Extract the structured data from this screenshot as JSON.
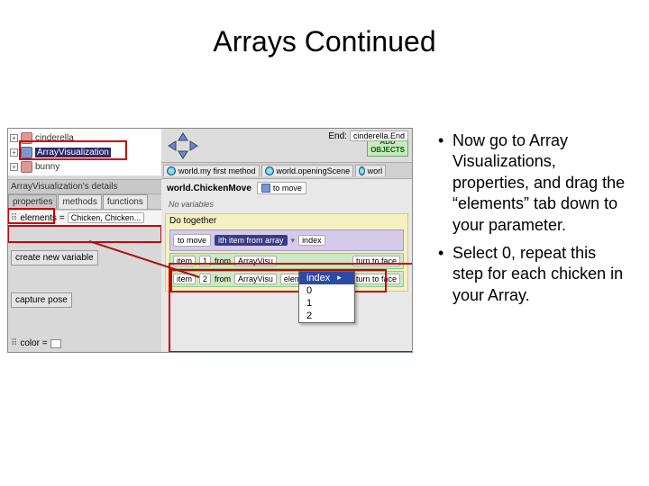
{
  "title": "Arrays Continued",
  "tree": {
    "items": [
      {
        "label": "cinderella"
      },
      {
        "label": "ArrayVisualization"
      },
      {
        "label": "bunny"
      }
    ]
  },
  "details_header": "ArrayVisualization's details",
  "tabs": {
    "properties": "properties",
    "methods": "methods",
    "functions": "functions"
  },
  "property": {
    "name": "elements",
    "equals": "=",
    "value": "Chicken, Chicken..."
  },
  "buttons": {
    "create_var": "create new variable",
    "capture_pose": "capture pose",
    "add_objects": "ADD\nOBJECTS"
  },
  "color_label": "color =",
  "end_label": "End:",
  "end_value": "cinderella.End",
  "method_tabs": {
    "a": "world.my first method",
    "b": "world.openingScene",
    "c": "worl"
  },
  "method_header": "world.ChickenMove",
  "param_label": "to move",
  "novars": "No variables",
  "dotogether": "Do together",
  "ith_row": {
    "prefix": "ith item from array",
    "index_label": "index"
  },
  "rows": [
    {
      "item": "item",
      "n": "1",
      "from": "from",
      "arr": "ArrayVisu",
      "turn": "turn to face"
    },
    {
      "item": "item",
      "n": "2",
      "from": "from",
      "arr": "ArrayVisu",
      "elems": "elements",
      "turn": "turn to face"
    }
  ],
  "dropdown": {
    "items": [
      "index",
      "0",
      "1",
      "2"
    ],
    "hover_index": 0
  },
  "bullets": [
    "Now go to Array Visualizations, properties, and drag the “elements” tab down to your parameter.",
    "Select 0, repeat this step for each chicken in your Array."
  ]
}
